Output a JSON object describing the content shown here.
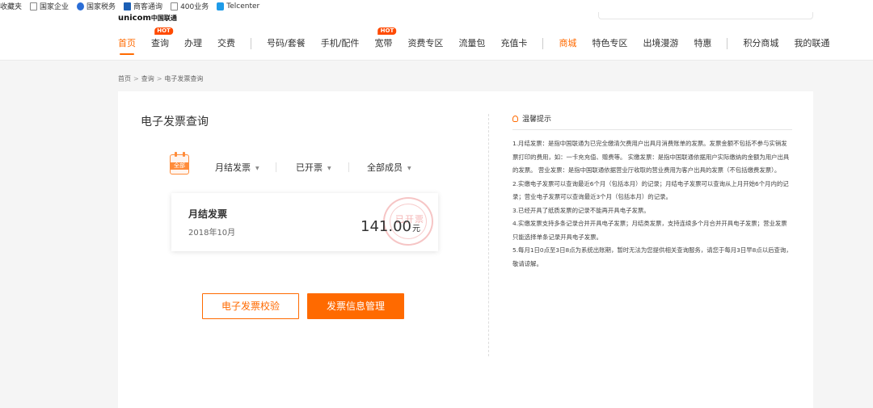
{
  "bookmarks": [
    {
      "label": "收藏夹",
      "icon": "none"
    },
    {
      "label": "国家企业",
      "icon": "page-icon"
    },
    {
      "label": "国家税务",
      "icon": "globe-icon"
    },
    {
      "label": "商客通询",
      "icon": "biz-icon"
    },
    {
      "label": "400业务",
      "icon": "page-icon"
    },
    {
      "label": "Telcenter",
      "icon": "telcenter-icon"
    }
  ],
  "header": {
    "logo_en": "unicom",
    "logo_cn": "中国联通",
    "nav": [
      {
        "label": "首页",
        "active": true
      },
      {
        "label": "查询",
        "hot": "HOT"
      },
      {
        "label": "办理"
      },
      {
        "label": "交费"
      },
      {
        "sep": true
      },
      {
        "label": "号码/套餐"
      },
      {
        "label": "手机/配件"
      },
      {
        "label": "宽带",
        "hot": "HOT"
      },
      {
        "label": "资费专区"
      },
      {
        "label": "流量包"
      },
      {
        "label": "充值卡"
      },
      {
        "sep": true
      },
      {
        "label": "商城",
        "orange": true
      },
      {
        "label": "特色专区"
      },
      {
        "label": "出境漫游"
      },
      {
        "label": "特惠"
      },
      {
        "sep": true
      },
      {
        "label": "积分商城"
      },
      {
        "label": "我的联通"
      }
    ]
  },
  "breadcrumb": [
    "首页",
    "查询",
    "电子发票查询"
  ],
  "page": {
    "title": "电子发票查询",
    "calendar_label": "全部",
    "filters": [
      "月结发票",
      "已开票",
      "全部成员"
    ],
    "invoice": {
      "title": "月结发票",
      "date": "2018年10月",
      "amount": "141.00",
      "unit": "元",
      "stamp": "已开票"
    },
    "buttons": {
      "verify": "电子发票校验",
      "manage": "发票信息管理"
    }
  },
  "tips": {
    "heading": "温馨提示",
    "lines": [
      "1.月结发票：是指中国联通为已完全缴清欠费用户出具月消费账单的发票。发票金额不包括不参与实销发票打印的费用，如：一卡充充值、赠费等。 实缴发票：是指中国联通依据用户实际缴纳的金额为用户出具的发票。 营业发票：是指中国联通依据营业厅收取的营业费用为客户出具的发票（不包括缴费发票）。",
      "2.实缴电子发票可以查询最近6个月（包括本月）的记录；月结电子发票可以查询从上月开始6个月内的记录；营业电子发票可以查询最近3个月（包括本月）的记录。",
      "3.已经开具了纸质发票的记录不能再开具电子发票。",
      "4.实缴发票支持多条记录合并开具电子发票；月结类发票，支持连续多个月合并开具电子发票；营业发票只能选择单条记录开具电子发票。",
      "5.每月1日0点至3日8点为系统出账期，暂时无法为您提供相关查询服务，请您于每月3日早8点以后查询，敬请谅解。"
    ]
  }
}
